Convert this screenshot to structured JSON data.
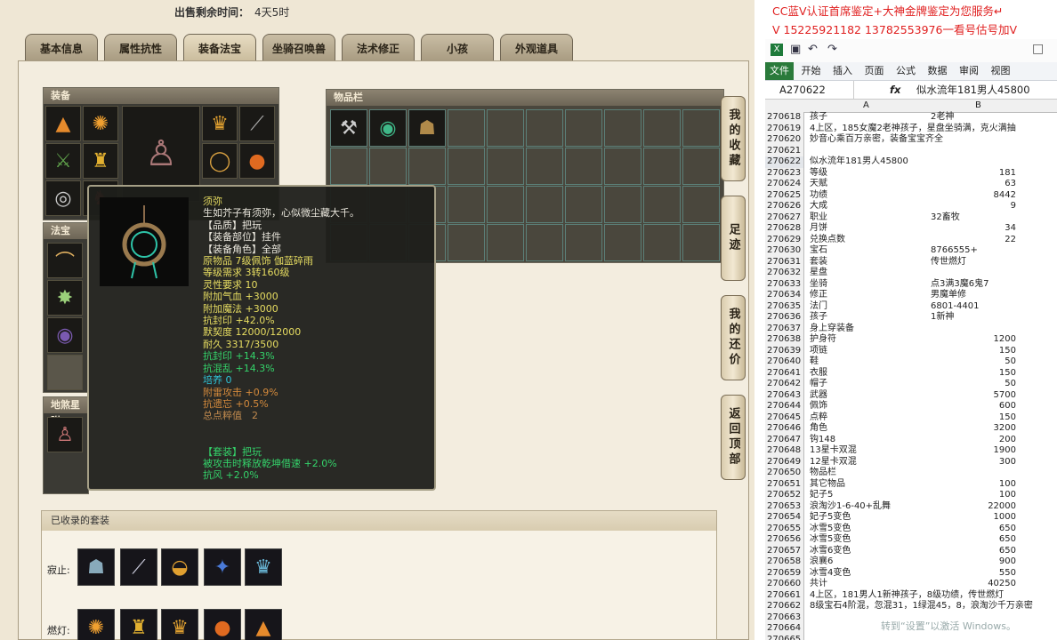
{
  "game": {
    "sale_label": "出售剩余时间：",
    "sale_value": "4天5时",
    "tabs": [
      "基本信息",
      "属性抗性",
      "装备法宝",
      "坐骑召唤兽",
      "法术修正",
      "小孩",
      "外观道具"
    ],
    "active_tab": 2,
    "equip_title": "装备",
    "fabao_title": "法宝",
    "disha_title": "地煞星附",
    "items_title": "物品栏",
    "side_buttons": [
      "我的收藏",
      "足迹",
      "我的还价",
      "返回顶部"
    ],
    "tooltip": {
      "lines": [
        {
          "text": "须弥",
          "color": "yellow"
        },
        {
          "text": "生如芥子有须弥，心似微尘藏大千。",
          "color": "white"
        },
        {
          "text": "【品质】把玩",
          "color": "white"
        },
        {
          "text": "【装备部位】挂件",
          "color": "white"
        },
        {
          "text": "【装备角色】全部",
          "color": "white"
        },
        {
          "text": "原物品 7级佩饰 伽蓝碎雨",
          "color": "yellow"
        },
        {
          "text": "等级需求 3转160级",
          "color": "yellow"
        },
        {
          "text": "灵性要求 10",
          "color": "yellow"
        },
        {
          "text": "附加气血 +3000",
          "color": "yellow"
        },
        {
          "text": "附加魔法 +3000",
          "color": "yellow"
        },
        {
          "text": "抗封印 +42.0%",
          "color": "yellow"
        },
        {
          "text": "默契度 12000/12000",
          "color": "yellow"
        },
        {
          "text": "耐久 3317/3500",
          "color": "yellow"
        },
        {
          "text": "抗封印 +14.3%",
          "color": "green"
        },
        {
          "text": "抗混乱 +14.3%",
          "color": "green"
        },
        {
          "text": "培养 0",
          "color": "cyan"
        },
        {
          "text": "附雷攻击 +0.9%",
          "color": "orange"
        },
        {
          "text": "抗遗忘 +0.5%",
          "color": "orange"
        },
        {
          "text": "总点粹值　2",
          "color": "brown"
        },
        {
          "text": "",
          "color": "white"
        },
        {
          "text": "",
          "color": "white"
        },
        {
          "text": "【套装】把玩",
          "color": "green"
        },
        {
          "text": "被攻击时释放乾坤借速 +2.0%",
          "color": "green"
        },
        {
          "text": "抗风 +2.0%",
          "color": "green"
        }
      ]
    },
    "suits_title": "已收录的套装",
    "suit_rows": [
      {
        "label": "寂止:"
      },
      {
        "label": "燃灯:"
      }
    ]
  },
  "excel": {
    "overlay_lines": [
      "CC蓝V认证首席鉴定+大神金牌鉴定为您服务↵",
      "V 15225921182    13782553976一看号估号加V"
    ],
    "ribbon_tabs": [
      "文件",
      "开始",
      "插入",
      "页面",
      "公式",
      "数据",
      "审阅",
      "视图"
    ],
    "namebox": "A270622",
    "formula_value": "似水流年181男人45800",
    "col_a": "A",
    "col_b": "B",
    "rows": [
      {
        "n": "270618",
        "a": "孩子",
        "b": "2老神",
        "num": false
      },
      {
        "n": "270619",
        "a": "4上区，185女魔2老神孩子，星盘坐骑满，克火满抽",
        "b": "",
        "num": false
      },
      {
        "n": "270620",
        "a": "妙音心乘百万亲密，装备宝宝齐全",
        "b": "",
        "num": false
      },
      {
        "n": "270621",
        "a": "",
        "b": "",
        "num": false
      },
      {
        "n": "270622",
        "a": "似水流年181男人45800",
        "b": "",
        "num": false,
        "sel": true
      },
      {
        "n": "270623",
        "a": "等级",
        "b": "181",
        "num": true
      },
      {
        "n": "270624",
        "a": "天赋",
        "b": "63",
        "num": true
      },
      {
        "n": "270625",
        "a": "功绩",
        "b": "8442",
        "num": true
      },
      {
        "n": "270626",
        "a": "大成",
        "b": "9",
        "num": true
      },
      {
        "n": "270627",
        "a": "职业",
        "b": "32畜牧",
        "num": false
      },
      {
        "n": "270628",
        "a": "月饼",
        "b": "34",
        "num": true
      },
      {
        "n": "270629",
        "a": "兑换点数",
        "b": "22",
        "num": true
      },
      {
        "n": "270630",
        "a": "宝石",
        "b": "8766555+",
        "num": false
      },
      {
        "n": "270631",
        "a": "套装",
        "b": "传世燃灯",
        "num": false
      },
      {
        "n": "270632",
        "a": "星盘",
        "b": "",
        "num": false
      },
      {
        "n": "270633",
        "a": "坐骑",
        "b": "点3满3魔6鬼7",
        "num": false
      },
      {
        "n": "270634",
        "a": "修正",
        "b": "男魔单修",
        "num": false
      },
      {
        "n": "270635",
        "a": "法门",
        "b": "6801-4401",
        "num": false
      },
      {
        "n": "270636",
        "a": "孩子",
        "b": "1新神",
        "num": false
      },
      {
        "n": "270637",
        "a": "身上穿装备",
        "b": "",
        "num": false
      },
      {
        "n": "270638",
        "a": "护身符",
        "b": "1200",
        "num": true
      },
      {
        "n": "270639",
        "a": "项链",
        "b": "150",
        "num": true
      },
      {
        "n": "270640",
        "a": "鞋",
        "b": "50",
        "num": true
      },
      {
        "n": "270641",
        "a": "衣服",
        "b": "150",
        "num": true
      },
      {
        "n": "270642",
        "a": "帽子",
        "b": "50",
        "num": true
      },
      {
        "n": "270643",
        "a": "武器",
        "b": "5700",
        "num": true
      },
      {
        "n": "270644",
        "a": "佩饰",
        "b": "600",
        "num": true
      },
      {
        "n": "270645",
        "a": "点粹",
        "b": "150",
        "num": true
      },
      {
        "n": "270646",
        "a": "角色",
        "b": "3200",
        "num": true
      },
      {
        "n": "270647",
        "a": "钩148",
        "b": "200",
        "num": true
      },
      {
        "n": "270648",
        "a": "13星卡双混",
        "b": "1900",
        "num": true
      },
      {
        "n": "270649",
        "a": "12星卡双混",
        "b": "300",
        "num": true
      },
      {
        "n": "270650",
        "a": "物品栏",
        "b": "",
        "num": false
      },
      {
        "n": "270651",
        "a": "其它物品",
        "b": "100",
        "num": true
      },
      {
        "n": "270652",
        "a": "妃子5",
        "b": "100",
        "num": true
      },
      {
        "n": "270653",
        "a": "浪淘沙1-6-40+乱舞",
        "b": "22000",
        "num": true
      },
      {
        "n": "270654",
        "a": "妃子5变色",
        "b": "1000",
        "num": true
      },
      {
        "n": "270655",
        "a": "冰雪5变色",
        "b": "650",
        "num": true
      },
      {
        "n": "270656",
        "a": "冰雪5变色",
        "b": "650",
        "num": true
      },
      {
        "n": "270657",
        "a": "冰雪6变色",
        "b": "650",
        "num": true
      },
      {
        "n": "270658",
        "a": "浪襄6",
        "b": "900",
        "num": true
      },
      {
        "n": "270659",
        "a": "冰雪4变色",
        "b": "550",
        "num": true
      },
      {
        "n": "270660",
        "a": "共计",
        "b": "40250",
        "num": true
      },
      {
        "n": "270661",
        "a": "4上区，181男人1新神孩子，8级功绩，传世燃灯",
        "b": "",
        "num": false
      },
      {
        "n": "270662",
        "a": "8级宝石4阶混，忽混31，1绿混45，8，浪淘沙千万亲密",
        "b": "",
        "num": false
      },
      {
        "n": "270663",
        "a": "",
        "b": "",
        "num": false
      },
      {
        "n": "270664",
        "a": "",
        "b": "",
        "num": false
      },
      {
        "n": "270665",
        "a": "",
        "b": "",
        "num": false
      }
    ],
    "watermark": "转到“设置”以激活 Windows。"
  }
}
